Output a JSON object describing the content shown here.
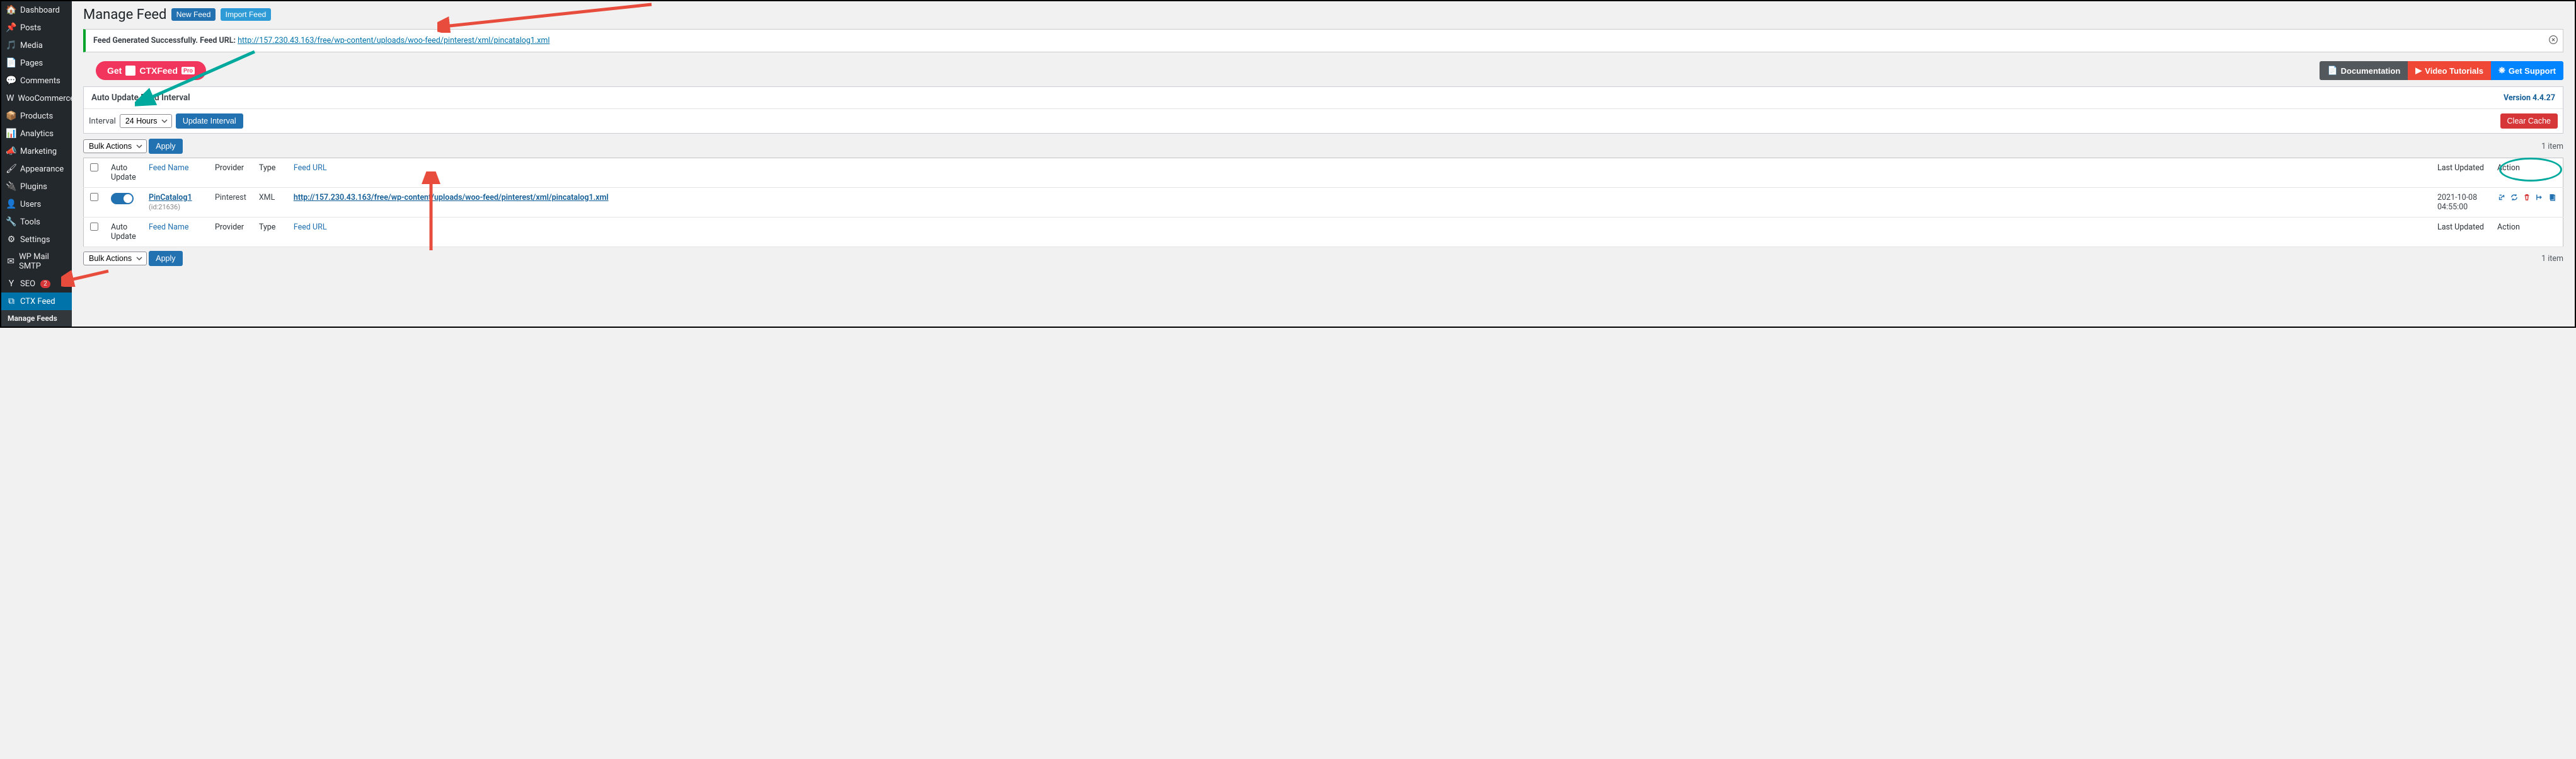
{
  "sidebar": {
    "items": [
      {
        "label": "Dashboard",
        "icon": "⌂"
      },
      {
        "label": "Posts",
        "icon": "✎"
      },
      {
        "label": "Media",
        "icon": "🖼"
      },
      {
        "label": "Pages",
        "icon": "📄"
      },
      {
        "label": "Comments",
        "icon": "💬"
      },
      {
        "label": "WooCommerce",
        "icon": "W"
      },
      {
        "label": "Products",
        "icon": "📦"
      },
      {
        "label": "Analytics",
        "icon": "📊"
      },
      {
        "label": "Marketing",
        "icon": "📢"
      },
      {
        "label": "Appearance",
        "icon": "🖌"
      },
      {
        "label": "Plugins",
        "icon": "🔌"
      },
      {
        "label": "Users",
        "icon": "👤"
      },
      {
        "label": "Tools",
        "icon": "🔧"
      },
      {
        "label": "Settings",
        "icon": "⚙"
      },
      {
        "label": "WP Mail SMTP",
        "icon": "✉"
      },
      {
        "label": "SEO",
        "icon": "Y",
        "badge": "2"
      },
      {
        "label": "CTX Feed",
        "icon": "⧉",
        "active": true
      },
      {
        "label": "Manage Feeds",
        "icon": "",
        "sub": true
      }
    ]
  },
  "page": {
    "title": "Manage Feed",
    "new_feed": "New Feed",
    "import_feed": "Import Feed"
  },
  "notice": {
    "prefix": "Feed Generated Successfully. Feed URL: ",
    "url": "http://157.230.43.163/free/wp-content/uploads/woo-feed/pinterest/xml/pincatalog1.xml"
  },
  "cta": {
    "get": "Get",
    "brand": "CTXFeed",
    "pro": "Pro"
  },
  "help": {
    "docs": "Documentation",
    "video": "Video Tutorials",
    "support": "Get Support"
  },
  "interval_panel": {
    "title": "Auto Update Feed Interval",
    "version": "Version 4.4.27",
    "interval_label": "Interval",
    "interval_value": "24 Hours",
    "update_btn": "Update Interval",
    "clear_btn": "Clear Cache"
  },
  "bulk": {
    "select": "Bulk Actions",
    "apply": "Apply",
    "count": "1 item"
  },
  "table": {
    "headers": {
      "auto": "Auto Update",
      "name": "Feed Name",
      "provider": "Provider",
      "type": "Type",
      "url": "Feed URL",
      "updated": "Last Updated",
      "action": "Action"
    },
    "rows": [
      {
        "name": "PinCatalog1",
        "id": "(id:21636)",
        "provider": "Pinterest",
        "type": "XML",
        "url": "http://157.230.43.163/free/wp-content/uploads/woo-feed/pinterest/xml/pincatalog1.xml",
        "updated": "2021-10-08 04:55:00"
      }
    ]
  }
}
